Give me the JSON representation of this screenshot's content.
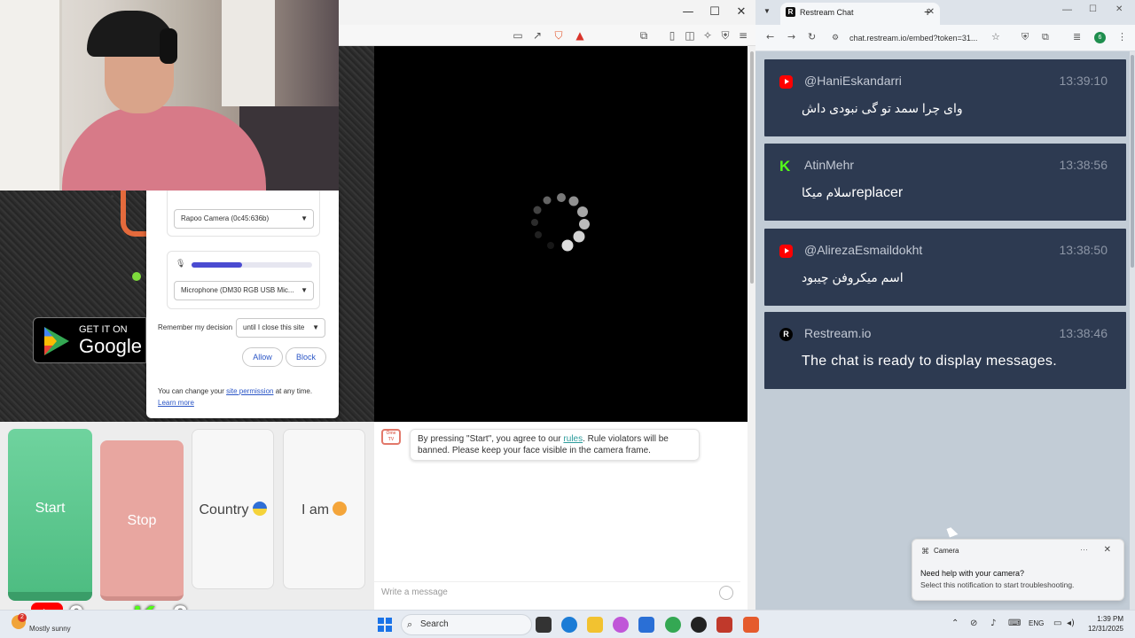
{
  "left_window": {
    "controls": {
      "minimize": "—",
      "maximize": "☐",
      "close": "✕"
    },
    "permission_popup": {
      "camera_select": "Rapoo Camera (0c45:636b)",
      "microphone_level": 0.42,
      "microphone_select": "Microphone (DM30 RGB USB Mic...",
      "remember_label": "Remember my decision",
      "remember_select": "until I close this site",
      "allow": "Allow",
      "block": "Block",
      "footer_prefix": "You can change your",
      "footer_link": "site permission",
      "footer_suffix": "at any time.",
      "learn_more": "Learn more"
    },
    "google_play": {
      "small": "GET IT ON",
      "big": "Google P"
    },
    "buttons": {
      "start": "Start",
      "stop": "Stop",
      "country": "Country",
      "iam": "I am"
    },
    "chat": {
      "logo": "Ome TV",
      "rules_prefix": "By pressing \"Start\", you agree to our",
      "rules_link": "rules",
      "rules_suffix": ". Rule violators will be banned. Please keep your face visible in the camera frame.",
      "input_placeholder": "Write a message"
    }
  },
  "overlays": {
    "youtube_count": "9",
    "kick_letter": "K",
    "kick_count": "2"
  },
  "right_window": {
    "tab_title": "Restream Chat",
    "tab_icon": "R",
    "url": "chat.restream.io/embed?token=31...",
    "profile_initial": "6",
    "messages": [
      {
        "platform": "youtube",
        "user": "@HaniEskandarri",
        "time": "13:39:10",
        "text": "وای چرا سمد تو گی نبودی داش"
      },
      {
        "platform": "kick",
        "user": "AtinMehr",
        "time": "13:38:56",
        "text": "سلام میکا",
        "image_alt": "replacer"
      },
      {
        "platform": "youtube",
        "user": "@AlirezaEsmaildokht",
        "time": "13:38:50",
        "text": "اسم میکروفن چیبود"
      },
      {
        "platform": "restream",
        "user": "Restream.io",
        "time": "13:38:46",
        "text": "The chat is ready to display messages."
      }
    ]
  },
  "notification": {
    "app": "Camera",
    "more": "···",
    "close": "✕",
    "title": "Need help with your camera?",
    "body": "Select this notification to start troubleshooting."
  },
  "taskbar": {
    "weather_badge": "2",
    "weather": "Mostly sunny",
    "search": "Search",
    "language": "ENG",
    "time": "1:39 PM",
    "date": "12/31/2025"
  }
}
